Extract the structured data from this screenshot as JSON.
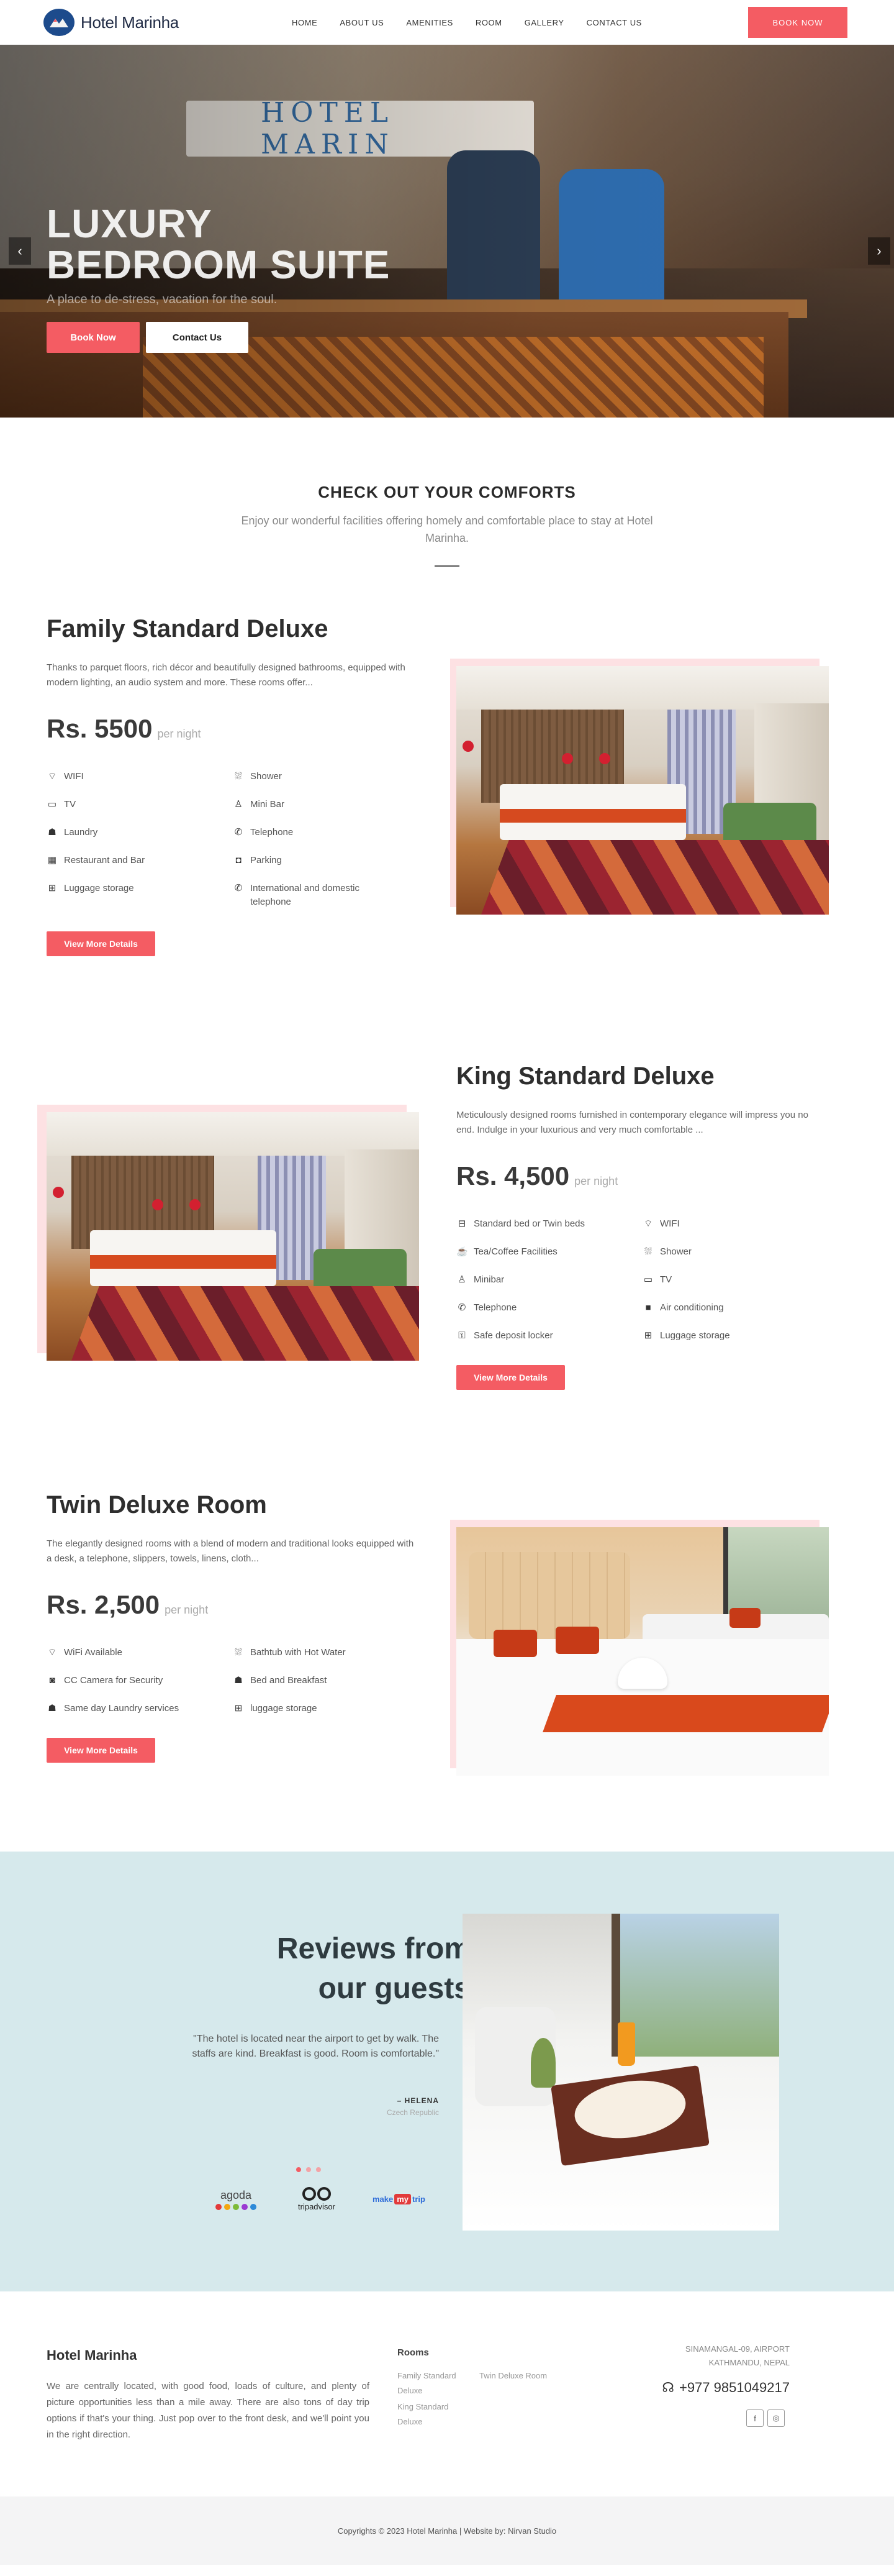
{
  "header": {
    "brand": "Hotel Marinha",
    "nav": [
      "HOME",
      "ABOUT US",
      "AMENITIES",
      "ROOM",
      "GALLERY",
      "CONTACT US"
    ],
    "cta": "BOOK NOW"
  },
  "hero": {
    "title_line1": "LUXURY",
    "title_line2": "BEDROOM SUITE",
    "subtitle": "A place to de-stress, vacation for the soul.",
    "btn_primary": "Book Now",
    "btn_secondary": "Contact Us",
    "prev_icon": "chevron-left-icon",
    "next_icon": "chevron-right-icon"
  },
  "comforts": {
    "heading": "CHECK OUT YOUR COMFORTS",
    "text": "Enjoy our wonderful facilities offering homely and comfortable place to stay at Hotel Marinha."
  },
  "rooms": [
    {
      "title": "Family Standard Deluxe",
      "desc": "Thanks to parquet floors, rich décor and beautifully designed bathrooms, equipped with modern lighting, an audio system and more. These rooms offer...",
      "price": "Rs. 5500",
      "per": "per night",
      "amenities": [
        {
          "icon": "wifi-icon",
          "glyph": "⌔",
          "label": "WIFI"
        },
        {
          "icon": "shower-icon",
          "glyph": "⛆",
          "label": "Shower"
        },
        {
          "icon": "tv-icon",
          "glyph": "▭",
          "label": "TV"
        },
        {
          "icon": "mini-bar-icon",
          "glyph": "♙",
          "label": "Mini Bar"
        },
        {
          "icon": "laundry-icon",
          "glyph": "☗",
          "label": "Laundry"
        },
        {
          "icon": "telephone-icon",
          "glyph": "✆",
          "label": "Telephone"
        },
        {
          "icon": "restaurant-icon",
          "glyph": "▦",
          "label": "Restaurant and Bar"
        },
        {
          "icon": "parking-icon",
          "glyph": "◘",
          "label": "Parking"
        },
        {
          "icon": "luggage-icon",
          "glyph": "⊞",
          "label": "Luggage storage"
        },
        {
          "icon": "phone-icon",
          "glyph": "✆",
          "label": "International and domestic telephone"
        }
      ],
      "button": "View More Details"
    },
    {
      "title": "King Standard Deluxe",
      "desc": "Meticulously designed rooms furnished in contemporary elegance will impress you no end. Indulge in your luxurious and very much comfortable ...",
      "price": "Rs. 4,500",
      "per": "per night",
      "amenities": [
        {
          "icon": "bed-icon",
          "glyph": "⊟",
          "label": "Standard bed or Twin beds"
        },
        {
          "icon": "wifi-icon",
          "glyph": "⌔",
          "label": "WIFI"
        },
        {
          "icon": "coffee-icon",
          "glyph": "☕",
          "label": "Tea/Coffee Facilities"
        },
        {
          "icon": "shower-icon",
          "glyph": "⛆",
          "label": "Shower"
        },
        {
          "icon": "minibar-icon",
          "glyph": "♙",
          "label": "Minibar"
        },
        {
          "icon": "tv-icon",
          "glyph": "▭",
          "label": "TV"
        },
        {
          "icon": "telephone-icon",
          "glyph": "✆",
          "label": "Telephone"
        },
        {
          "icon": "air-conditioning-icon",
          "glyph": "■",
          "label": "Air conditioning"
        },
        {
          "icon": "key-icon",
          "glyph": "⚿",
          "label": "Safe deposit locker"
        },
        {
          "icon": "luggage-icon",
          "glyph": "⊞",
          "label": "Luggage storage"
        }
      ],
      "button": "View More Details"
    },
    {
      "title": "Twin Deluxe Room",
      "desc": "The elegantly designed rooms with a blend of modern and traditional looks equipped with a desk, a telephone, slippers, towels, linens, cloth...",
      "price": "Rs. 2,500",
      "per": "per night",
      "amenities": [
        {
          "icon": "wifi-icon",
          "glyph": "⌔",
          "label": "WiFi Available"
        },
        {
          "icon": "bathtub-icon",
          "glyph": "⛆",
          "label": "Bathtub with Hot Water"
        },
        {
          "icon": "camera-icon",
          "glyph": "◙",
          "label": "CC Camera for Security"
        },
        {
          "icon": "breakfast-icon",
          "glyph": "☗",
          "label": "Bed and Breakfast"
        },
        {
          "icon": "laundry-icon",
          "glyph": "☗",
          "label": "Same day Laundry services"
        },
        {
          "icon": "luggage-icon",
          "glyph": "⊞",
          "label": "luggage storage"
        }
      ],
      "button": "View More Details"
    }
  ],
  "reviews": {
    "heading_line1": "Reviews from",
    "heading_line2": "our guests",
    "quote": "\"The hotel is located near the airport to get by walk. The staffs are kind. Breakfast is good. Room is comfortable.\"",
    "author": "– HELENA",
    "country": "Czech Republic",
    "partners": {
      "agoda": "agoda",
      "tripadvisor": "tripadvisor",
      "mmt_make": "make",
      "mmt_my": "my",
      "mmt_trip": "trip"
    }
  },
  "footer": {
    "title": "Hotel Marinha",
    "about": "We are centrally located, with good food, loads of culture, and plenty of picture opportunities less than a mile away. There are also tons of day trip options if that's your thing. Just pop over to the front desk, and we'll point you in the right direction.",
    "rooms_heading": "Rooms",
    "room_links": [
      "Family Standard Deluxe",
      "Twin Deluxe Room",
      "King Standard Deluxe"
    ],
    "address_line1": "SINAMANGAL-09, AIRPORT",
    "address_line2": "KATHMANDU, NEPAL",
    "phone": "+977 9851049217",
    "social": [
      "f",
      "◎"
    ]
  },
  "copyright": "Copyrights © 2023 Hotel Marinha | Website by: Nirvan Studio"
}
